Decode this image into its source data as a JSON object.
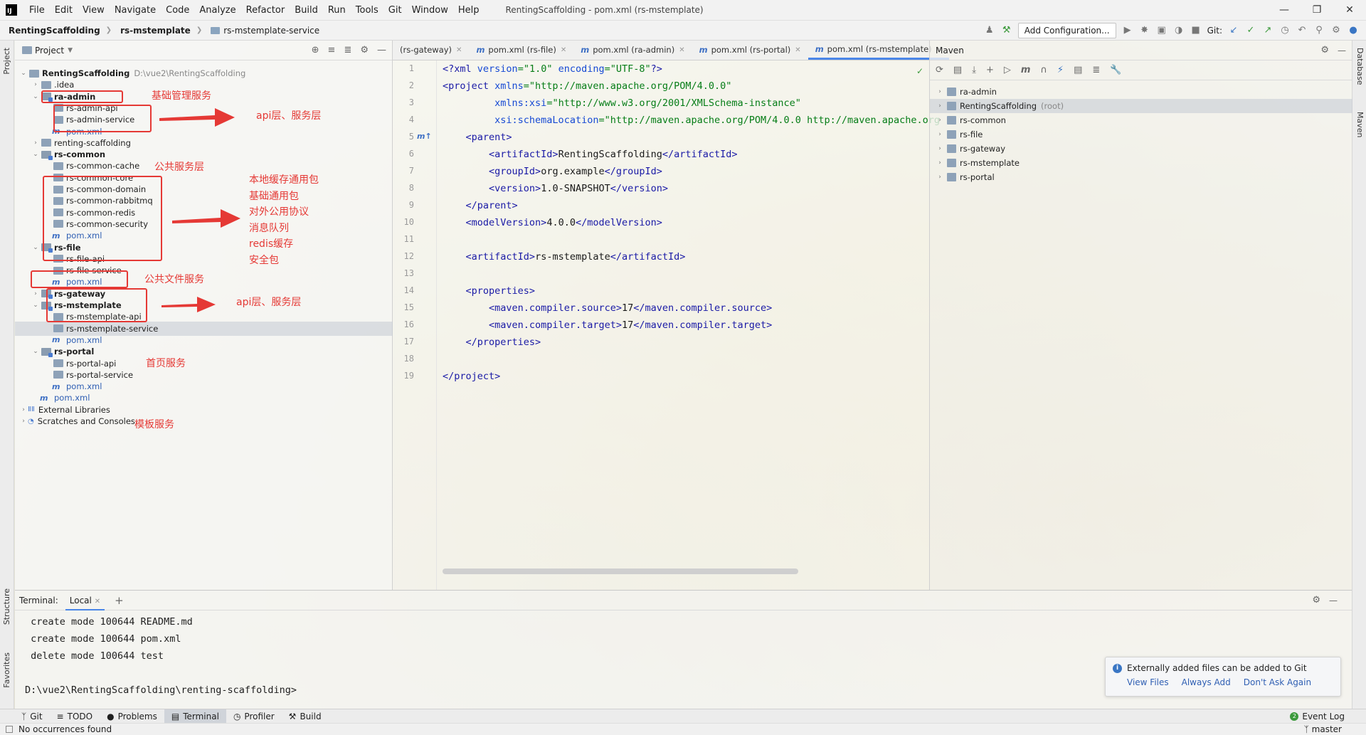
{
  "window": {
    "title": "RentingScaffolding - pom.xml (rs-mstemplate)",
    "menu": [
      "File",
      "Edit",
      "View",
      "Navigate",
      "Code",
      "Analyze",
      "Refactor",
      "Build",
      "Run",
      "Tools",
      "Git",
      "Window",
      "Help"
    ]
  },
  "navbar": {
    "crumbs": [
      "RentingScaffolding",
      "rs-mstemplate",
      "rs-mstemplate-service"
    ],
    "add_config": "Add Configuration...",
    "git_label": "Git:"
  },
  "project": {
    "header": "Project",
    "tree": [
      {
        "label": "RentingScaffolding",
        "bold": true,
        "extra": "D:\\vue2\\RentingScaffolding",
        "indent": 0,
        "arrow": "v",
        "icon": "folder"
      },
      {
        "label": ".idea",
        "indent": 1,
        "arrow": ">",
        "icon": "folder"
      },
      {
        "label": "ra-admin",
        "bold": true,
        "indent": 1,
        "arrow": "v",
        "icon": "module"
      },
      {
        "label": "rs-admin-api",
        "indent": 2,
        "arrow": "",
        "icon": "folder"
      },
      {
        "label": "rs-admin-service",
        "indent": 2,
        "arrow": "",
        "icon": "folder"
      },
      {
        "label": "pom.xml",
        "indent": 2,
        "arrow": "",
        "icon": "maven"
      },
      {
        "label": "renting-scaffolding",
        "indent": 1,
        "arrow": ">",
        "icon": "folder"
      },
      {
        "label": "rs-common",
        "bold": true,
        "indent": 1,
        "arrow": "v",
        "icon": "module"
      },
      {
        "label": "rs-common-cache",
        "indent": 2,
        "arrow": "",
        "icon": "folder"
      },
      {
        "label": "rs-common-core",
        "indent": 2,
        "arrow": "",
        "icon": "folder"
      },
      {
        "label": "rs-common-domain",
        "indent": 2,
        "arrow": "",
        "icon": "folder"
      },
      {
        "label": "rs-common-rabbitmq",
        "indent": 2,
        "arrow": "",
        "icon": "folder"
      },
      {
        "label": "rs-common-redis",
        "indent": 2,
        "arrow": "",
        "icon": "folder"
      },
      {
        "label": "rs-common-security",
        "indent": 2,
        "arrow": "",
        "icon": "folder"
      },
      {
        "label": "pom.xml",
        "indent": 2,
        "arrow": "",
        "icon": "maven"
      },
      {
        "label": "rs-file",
        "bold": true,
        "indent": 1,
        "arrow": "v",
        "icon": "module"
      },
      {
        "label": "rs-file-api",
        "indent": 2,
        "arrow": "",
        "icon": "folder"
      },
      {
        "label": "rs-file-service",
        "indent": 2,
        "arrow": "",
        "icon": "folder"
      },
      {
        "label": "pom.xml",
        "indent": 2,
        "arrow": "",
        "icon": "maven"
      },
      {
        "label": "rs-gateway",
        "bold": true,
        "indent": 1,
        "arrow": ">",
        "icon": "module"
      },
      {
        "label": "rs-mstemplate",
        "bold": true,
        "indent": 1,
        "arrow": "v",
        "icon": "module"
      },
      {
        "label": "rs-mstemplate-api",
        "indent": 2,
        "arrow": "",
        "icon": "folder"
      },
      {
        "label": "rs-mstemplate-service",
        "indent": 2,
        "arrow": "",
        "icon": "folder",
        "selected": true
      },
      {
        "label": "pom.xml",
        "indent": 2,
        "arrow": "",
        "icon": "maven"
      },
      {
        "label": "rs-portal",
        "bold": true,
        "indent": 1,
        "arrow": "v",
        "icon": "module"
      },
      {
        "label": "rs-portal-api",
        "indent": 2,
        "arrow": "",
        "icon": "folder"
      },
      {
        "label": "rs-portal-service",
        "indent": 2,
        "arrow": "",
        "icon": "folder"
      },
      {
        "label": "pom.xml",
        "indent": 2,
        "arrow": "",
        "icon": "maven"
      },
      {
        "label": "pom.xml",
        "indent": 1,
        "arrow": "",
        "icon": "maven"
      },
      {
        "label": "External Libraries",
        "indent": 0,
        "arrow": ">",
        "icon": "lib"
      },
      {
        "label": "Scratches and Consoles",
        "indent": 0,
        "arrow": ">",
        "icon": "scratch"
      }
    ]
  },
  "annotations": {
    "admin_label": "基础管理服务",
    "admin_arrow": "api层、服务层",
    "common_label": "公共服务层",
    "common_desc": [
      "本地缓存通用包",
      "基础通用包",
      "对外公用协议",
      "消息队列",
      "redis缓存",
      "安全包"
    ],
    "file_label": "公共文件服务",
    "file_arrow": "api层、服务层",
    "mstemplate_label": "首页服务",
    "portal_label": "模板服务"
  },
  "editor": {
    "tabs": [
      {
        "label": "(rs-gateway)",
        "icon": false
      },
      {
        "label": "pom.xml (rs-file)",
        "icon": true
      },
      {
        "label": "pom.xml (ra-admin)",
        "icon": true
      },
      {
        "label": "pom.xml (rs-portal)",
        "icon": true
      },
      {
        "label": "pom.xml (rs-mstemplate)",
        "icon": true,
        "active": true
      }
    ],
    "line_numbers": [
      "1",
      "2",
      "3",
      "4",
      "5",
      "6",
      "7",
      "8",
      "9",
      "10",
      "11",
      "12",
      "13",
      "14",
      "15",
      "16",
      "17",
      "18",
      "19"
    ]
  },
  "maven": {
    "header": "Maven",
    "items": [
      {
        "label": "ra-admin"
      },
      {
        "label": "RentingScaffolding",
        "suffix": "(root)",
        "selected": true
      },
      {
        "label": "rs-common"
      },
      {
        "label": "rs-file"
      },
      {
        "label": "rs-gateway"
      },
      {
        "label": "rs-mstemplate"
      },
      {
        "label": "rs-portal"
      }
    ]
  },
  "terminal": {
    "label": "Terminal:",
    "tab": "Local",
    "lines": [
      " create mode 100644 README.md",
      " create mode 100644 pom.xml",
      " delete mode 100644 test",
      "",
      "D:\\vue2\\RentingScaffolding\\renting-scaffolding>"
    ]
  },
  "notification": {
    "text": "Externally added files can be added to Git",
    "links": [
      "View Files",
      "Always Add",
      "Don't Ask Again"
    ]
  },
  "bottom_tools": [
    "Git",
    "TODO",
    "Problems",
    "Terminal",
    "Profiler",
    "Build"
  ],
  "event_log": "Event Log",
  "status": {
    "left": "No occurrences found",
    "branch": "master"
  },
  "side_labels": {
    "project": "Project",
    "structure": "Structure",
    "favorites": "Favorites",
    "database": "Database",
    "maven": "Maven"
  }
}
